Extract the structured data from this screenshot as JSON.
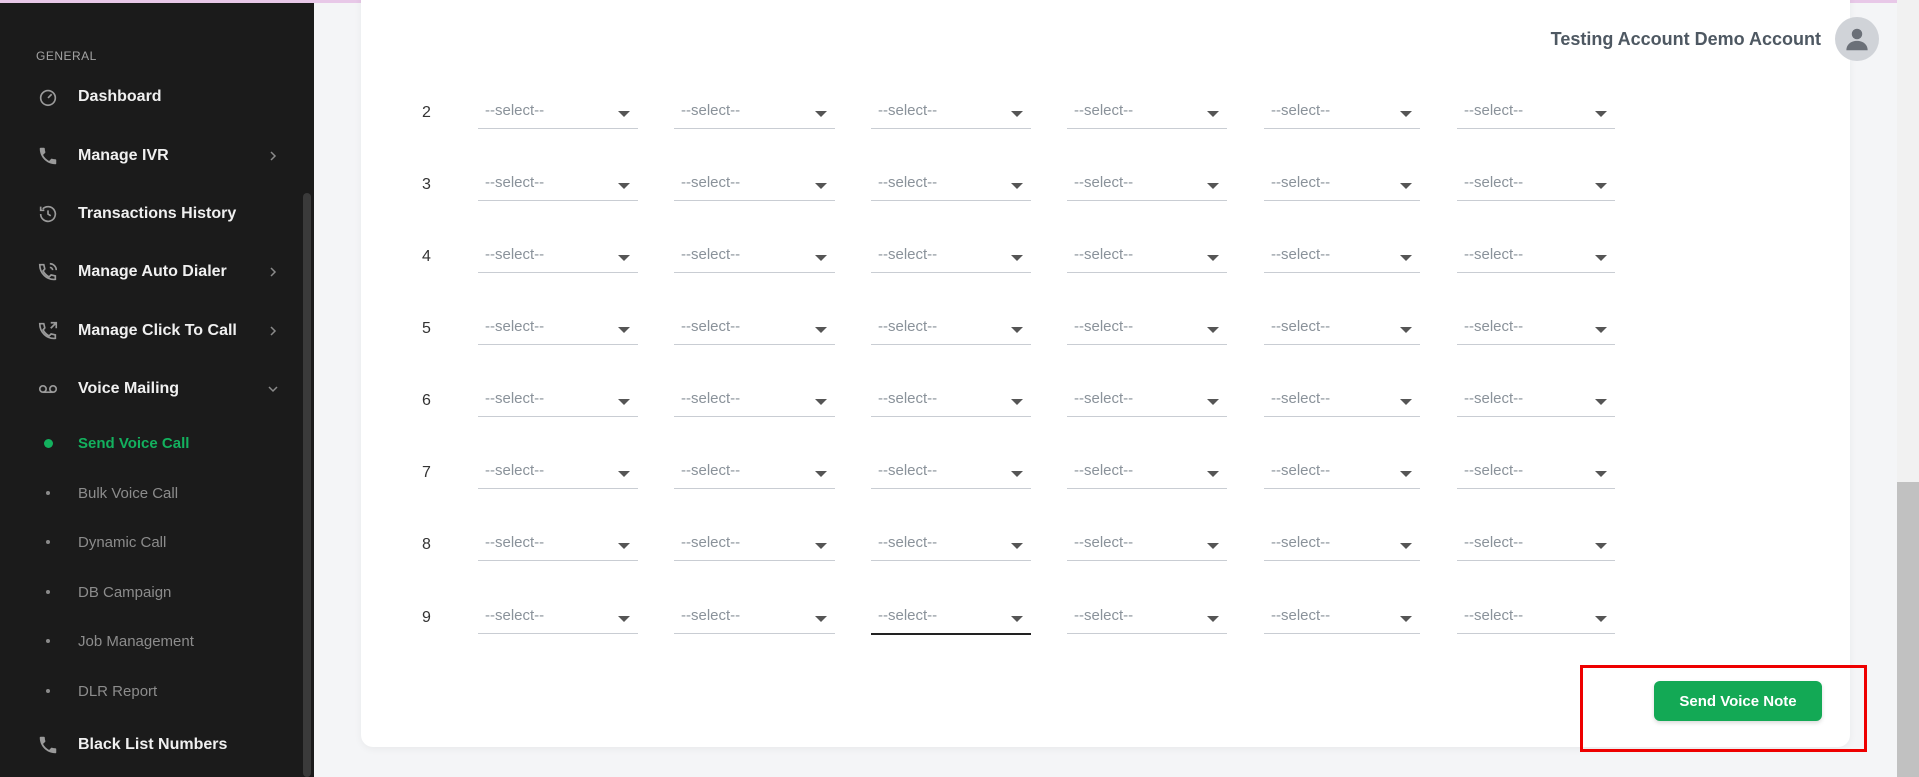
{
  "sidebar": {
    "section_label": "GENERAL",
    "items": [
      {
        "label": "Dashboard",
        "icon": "gauge-icon"
      },
      {
        "label": "Manage IVR",
        "icon": "phone-icon",
        "has_chevron": true
      },
      {
        "label": "Transactions History",
        "icon": "history-icon"
      },
      {
        "label": "Manage Auto Dialer",
        "icon": "phone-dialer-icon",
        "has_chevron": true
      },
      {
        "label": "Manage Click To Call",
        "icon": "phone-forward-icon",
        "has_chevron": true
      },
      {
        "label": "Voice Mailing",
        "icon": "voicemail-icon",
        "expanded": true
      }
    ],
    "sub_items": [
      {
        "label": "Send Voice Call",
        "active": true
      },
      {
        "label": "Bulk Voice Call"
      },
      {
        "label": "Dynamic Call"
      },
      {
        "label": "DB Campaign"
      },
      {
        "label": "Job Management"
      },
      {
        "label": "DLR Report"
      }
    ],
    "bottom_item": {
      "label": "Black List Numbers",
      "icon": "phone-icon"
    }
  },
  "header": {
    "user_name": "Testing Account Demo Account"
  },
  "table": {
    "placeholder": "--select--",
    "rows": [
      "2",
      "3",
      "4",
      "5",
      "6",
      "7",
      "8",
      "9"
    ]
  },
  "send_button": {
    "label": "Send Voice Note"
  },
  "colors": {
    "accent": "#13a955",
    "active_nav": "#13b15e",
    "highlight": "#ee0000"
  }
}
